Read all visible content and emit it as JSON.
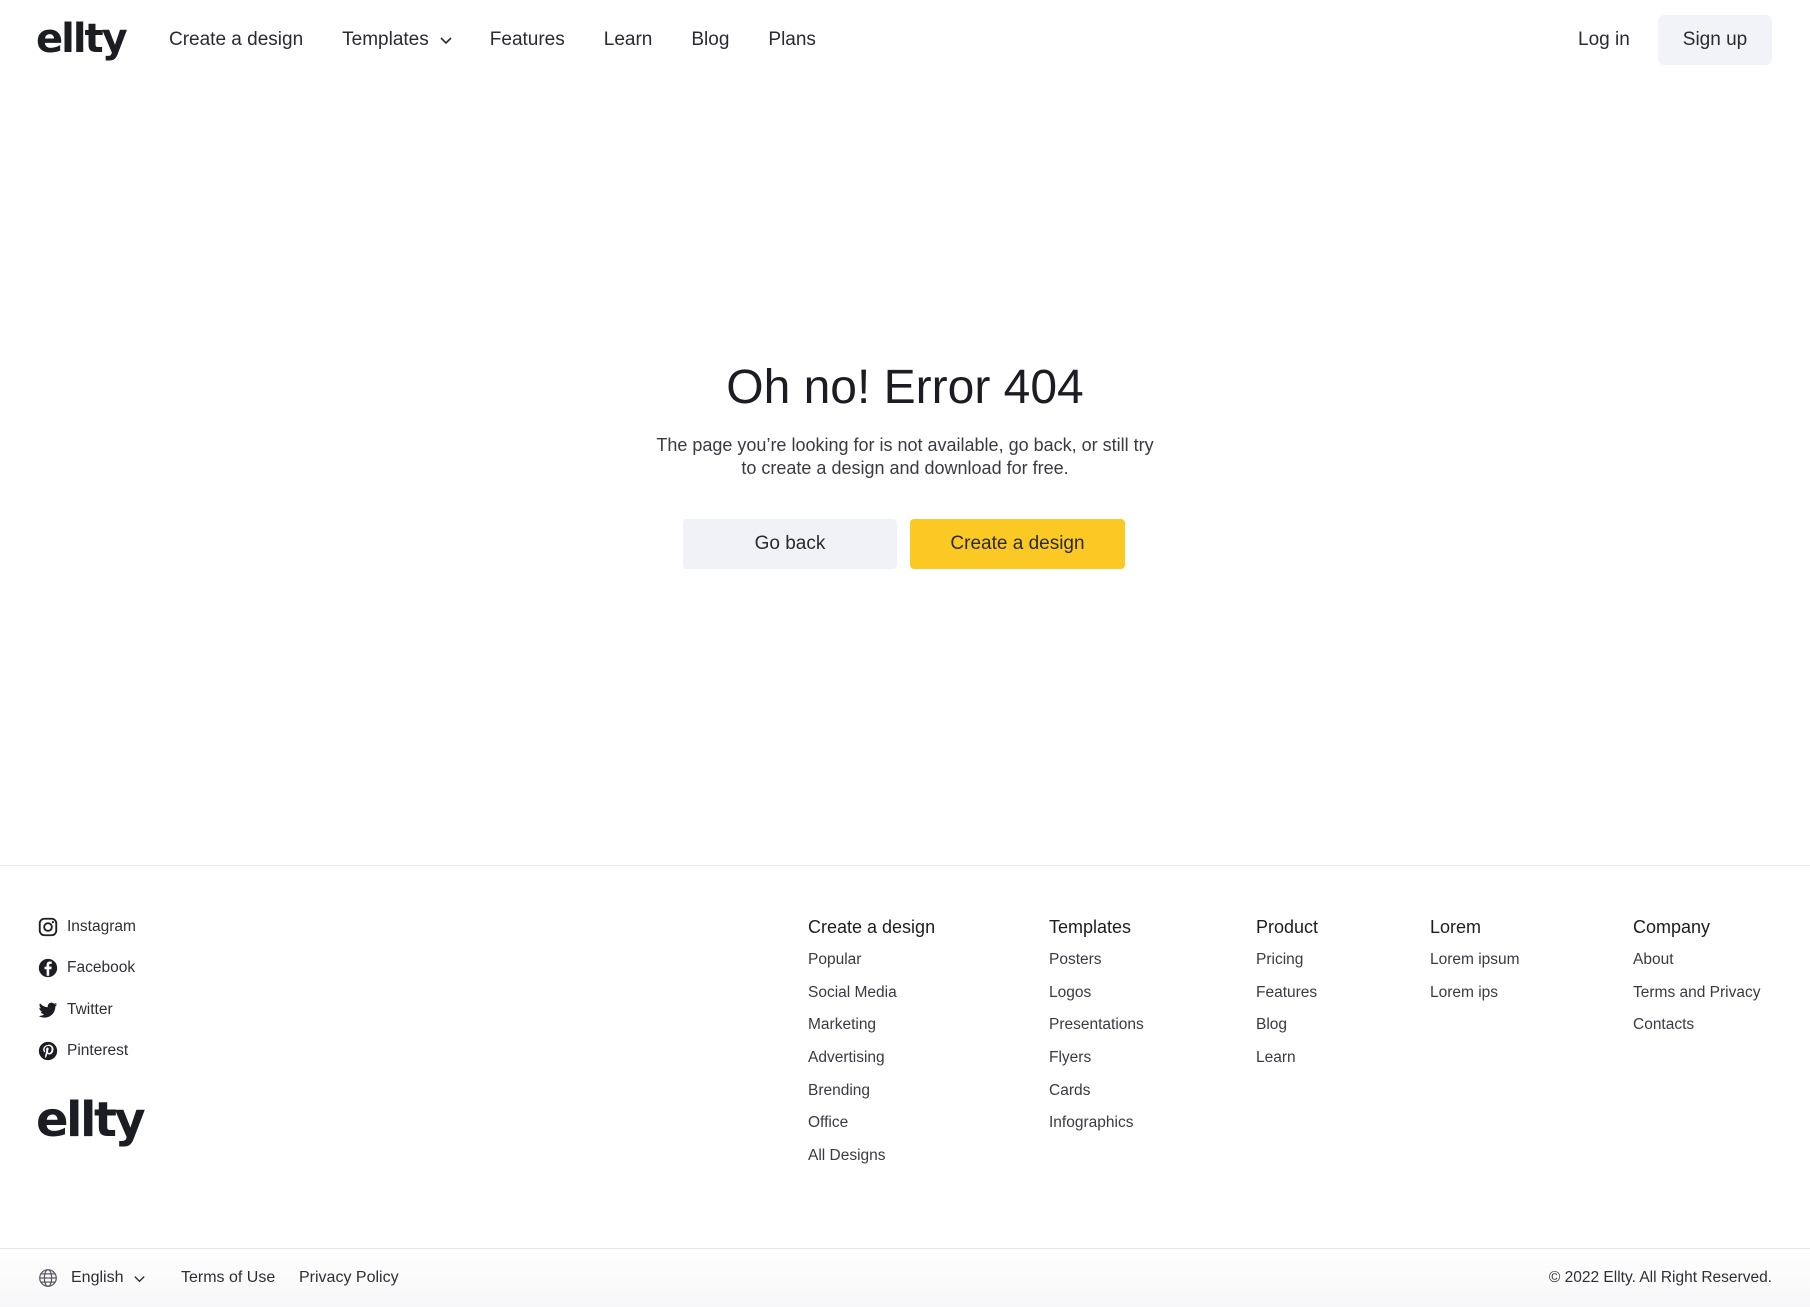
{
  "brand": {
    "logo_text": "ellty"
  },
  "nav": {
    "items": [
      {
        "label": "Create a design"
      },
      {
        "label": "Templates",
        "has_dropdown": true
      },
      {
        "label": "Features"
      },
      {
        "label": "Learn"
      },
      {
        "label": "Blog"
      },
      {
        "label": "Plans"
      }
    ],
    "login_label": "Log in",
    "signup_label": "Sign up"
  },
  "error": {
    "title": "Oh no! Error 404",
    "description": "The page you’re looking for is not available, go back, or still try to create a design and download for free.",
    "back_label": "Go back",
    "create_label": "Create a design"
  },
  "footer": {
    "social": [
      {
        "label": "Instagram",
        "icon": "instagram-icon"
      },
      {
        "label": "Facebook",
        "icon": "facebook-icon"
      },
      {
        "label": "Twitter",
        "icon": "twitter-icon"
      },
      {
        "label": "Pinterest",
        "icon": "pinterest-icon"
      }
    ],
    "logo_text": "ellty",
    "columns": [
      {
        "title": "Create a design",
        "links": [
          "Popular",
          "Social Media",
          "Marketing",
          "Advertising",
          "Brending",
          "Office",
          "All Designs"
        ]
      },
      {
        "title": "Templates",
        "links": [
          "Posters",
          "Logos",
          "Presentations",
          "Flyers",
          "Cards",
          "Infographics"
        ]
      },
      {
        "title": "Product",
        "links": [
          "Pricing",
          "Features",
          "Blog",
          "Learn"
        ]
      },
      {
        "title": "Lorem",
        "links": [
          "Lorem ipsum",
          "Lorem ips"
        ]
      },
      {
        "title": "Company",
        "links": [
          "About",
          "Terms and Privacy",
          "Contacts"
        ]
      }
    ]
  },
  "bottom_bar": {
    "language": "English",
    "terms_label": "Terms of Use",
    "privacy_label": "Privacy Policy",
    "copyright": "© 2022 Ellty. All Right Reserved."
  },
  "colors": {
    "accent": "#FCC924",
    "secondary_button": "#F0F2F8",
    "text": "#1C1D22"
  }
}
